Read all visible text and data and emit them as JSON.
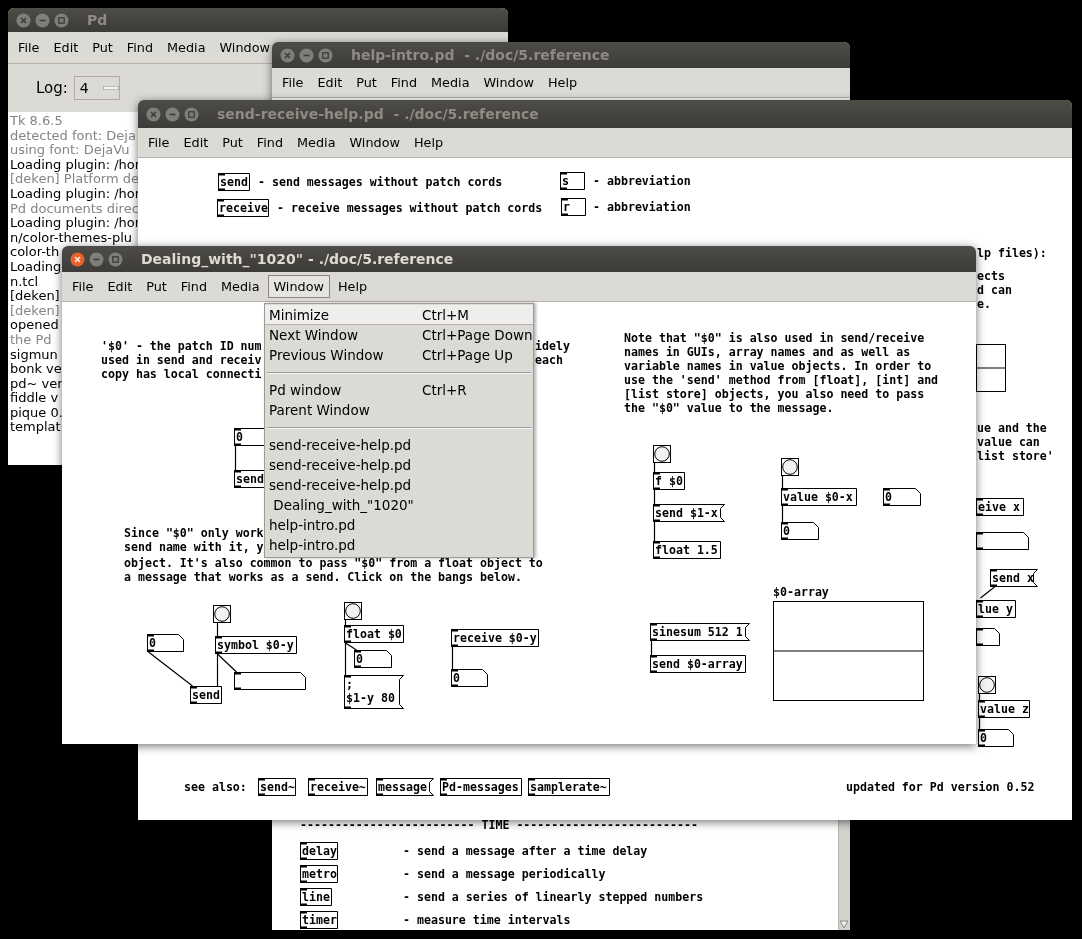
{
  "windows": [
    {
      "kind": "console",
      "title": "Pd",
      "active": false,
      "menus": [
        {
          "label": "File",
          "selected": false
        },
        {
          "label": "Edit",
          "selected": false
        },
        {
          "label": "Put",
          "selected": false
        },
        {
          "label": "Find",
          "selected": false
        },
        {
          "label": "Media",
          "selected": false
        },
        {
          "label": "Window",
          "selected": false
        }
      ],
      "log_label": "Log:",
      "log_value": "4",
      "lines": [
        {
          "text": "Tk 8.6.5",
          "dim": true
        },
        {
          "text": "detected font: Deja",
          "dim": true
        },
        {
          "text": "using font: DejaVu",
          "dim": true
        },
        {
          "text": "Loading plugin: /hor",
          "dim": false
        },
        {
          "text": "[deken] Platform de",
          "dim": true
        },
        {
          "text": "Loading plugin: /hor",
          "dim": false
        },
        {
          "text": "Pd documents direc",
          "dim": true
        },
        {
          "text": "Loading plugin: /hor",
          "dim": false
        },
        {
          "text": "n/color-themes-plu",
          "dim": false
        },
        {
          "text": "color-th",
          "dim": false
        },
        {
          "text": "Loading",
          "dim": false
        },
        {
          "text": "n.tcl",
          "dim": false
        },
        {
          "text": "[deken]",
          "dim": false
        },
        {
          "text": "[deken]",
          "dim": true
        },
        {
          "text": "opened",
          "dim": false
        },
        {
          "text": "the Pd",
          "dim": true
        },
        {
          "text": "sigmun",
          "dim": false
        },
        {
          "text": "bonk ve",
          "dim": false
        },
        {
          "text": "pd~ ver",
          "dim": false
        },
        {
          "text": "fiddle v",
          "dim": false
        },
        {
          "text": "pique 0.",
          "dim": false
        },
        {
          "text": "templat",
          "dim": false
        }
      ]
    },
    {
      "kind": "patch",
      "title": "help-intro.pd  - ./doc/5.reference",
      "active": false,
      "menus": [
        {
          "label": "File",
          "selected": false
        },
        {
          "label": "Edit",
          "selected": false
        },
        {
          "label": "Put",
          "selected": false
        },
        {
          "label": "Find",
          "selected": false
        },
        {
          "label": "Media",
          "selected": false
        },
        {
          "label": "Window",
          "selected": false
        },
        {
          "label": "Help",
          "selected": false
        }
      ],
      "objects": [
        {
          "kind": "comment",
          "text": "------------------------- TIME --------------------------"
        },
        {
          "kind": "obj",
          "text": "delay"
        },
        {
          "kind": "comment",
          "text": "- send a message after a time delay"
        },
        {
          "kind": "obj",
          "text": "metro"
        },
        {
          "kind": "comment",
          "text": "- send a message periodically"
        },
        {
          "kind": "obj",
          "text": "line"
        },
        {
          "kind": "comment",
          "text": "- send a series of linearly stepped numbers"
        },
        {
          "kind": "obj",
          "text": "timer"
        },
        {
          "kind": "comment",
          "text": "- measure time intervals"
        }
      ]
    },
    {
      "kind": "patch",
      "title": "send-receive-help.pd  - ./doc/5.reference",
      "active": false,
      "menus": [
        {
          "label": "File",
          "selected": false
        },
        {
          "label": "Edit",
          "selected": false
        },
        {
          "label": "Put",
          "selected": false
        },
        {
          "label": "Find",
          "selected": false
        },
        {
          "label": "Media",
          "selected": false
        },
        {
          "label": "Window",
          "selected": false
        },
        {
          "label": "Help",
          "selected": false
        }
      ],
      "objects": [
        {
          "kind": "obj",
          "text": "send"
        },
        {
          "kind": "comment",
          "text": "- send messages without patch cords"
        },
        {
          "kind": "obj",
          "text": "receive"
        },
        {
          "kind": "comment",
          "text": "- receive messages without patch cords"
        },
        {
          "kind": "obj",
          "text": "s"
        },
        {
          "kind": "comment",
          "text": "- abbreviation"
        },
        {
          "kind": "obj",
          "text": "r"
        },
        {
          "kind": "comment",
          "text": "- abbreviation"
        },
        {
          "kind": "comment",
          "text": "lp files):"
        },
        {
          "kind": "comment",
          "text": "ects\nd can\ne."
        },
        {
          "kind": "array"
        },
        {
          "kind": "comment",
          "text": "ue and the\nvalue can\nlist store'"
        },
        {
          "kind": "obj",
          "text": "eive x"
        },
        {
          "kind": "atom"
        },
        {
          "kind": "msg",
          "text": "send x"
        },
        {
          "kind": "obj",
          "text": "lue y"
        },
        {
          "kind": "atom"
        },
        {
          "kind": "bng"
        },
        {
          "kind": "obj",
          "text": "value z"
        },
        {
          "kind": "num",
          "text": "0"
        },
        {
          "kind": "comment",
          "text": "see also:"
        },
        {
          "kind": "obj",
          "text": "send~"
        },
        {
          "kind": "obj",
          "text": "receive~"
        },
        {
          "kind": "msg",
          "text": "message"
        },
        {
          "kind": "obj",
          "text": "Pd-messages"
        },
        {
          "kind": "obj",
          "text": "samplerate~"
        },
        {
          "kind": "comment",
          "text": "updated for Pd version 0.52"
        }
      ]
    },
    {
      "kind": "patch",
      "title": "Dealing_with_\"1020\" - ./doc/5.reference",
      "active": true,
      "menus": [
        {
          "label": "File",
          "selected": false
        },
        {
          "label": "Edit",
          "selected": false
        },
        {
          "label": "Put",
          "selected": false
        },
        {
          "label": "Find",
          "selected": false
        },
        {
          "label": "Media",
          "selected": false
        },
        {
          "label": "Window",
          "selected": true
        },
        {
          "label": "Help",
          "selected": false
        }
      ],
      "objects": [
        {
          "kind": "comment",
          "text": "'$0' - the patch ID num\nused in send and receiv\ncopy has local connecti"
        },
        {
          "kind": "comment",
          "text": "idely"
        },
        {
          "kind": "comment",
          "text": "each"
        },
        {
          "kind": "comment",
          "text": "Since \"$0\" only work\nsend name with it, y"
        },
        {
          "kind": "comment",
          "text": "object. It's also common to pass \"$0\" from a float object to\na message that works as a send. Click on the bangs below."
        },
        {
          "kind": "comment",
          "text": "Note that \"$0\" is also used in send/receive\nnames in GUIs, array names and as well as\nvariable names in value objects. In order to\nuse the 'send' method from [float], [int] and\n[list store] objects, you also need to pass\nthe \"$0\" value to the message."
        },
        {
          "kind": "num",
          "text": "0"
        },
        {
          "kind": "obj",
          "text": "send"
        },
        {
          "kind": "bng"
        },
        {
          "kind": "num",
          "text": "0"
        },
        {
          "kind": "obj",
          "text": "symbol $0-y"
        },
        {
          "kind": "atom"
        },
        {
          "kind": "obj",
          "text": "send"
        },
        {
          "kind": "bng"
        },
        {
          "kind": "obj",
          "text": "float $0"
        },
        {
          "kind": "num",
          "text": "0"
        },
        {
          "kind": "msg",
          "text": ";\n$1-y 80"
        },
        {
          "kind": "obj",
          "text": "receive $0-y"
        },
        {
          "kind": "num",
          "text": "0"
        },
        {
          "kind": "bng"
        },
        {
          "kind": "obj",
          "text": "f $0"
        },
        {
          "kind": "msg",
          "text": "send $1-x"
        },
        {
          "kind": "obj",
          "text": "float 1.5"
        },
        {
          "kind": "bng"
        },
        {
          "kind": "obj",
          "text": "value $0-x"
        },
        {
          "kind": "num",
          "text": "0"
        },
        {
          "kind": "num",
          "text": "0"
        },
        {
          "kind": "msg",
          "text": "sinesum 512 1"
        },
        {
          "kind": "obj",
          "text": "send $0-array"
        },
        {
          "kind": "array",
          "text": "$0-array"
        }
      ],
      "menu_dropdown": [
        {
          "kind": "item",
          "label": "Minimize",
          "shortcut": "Ctrl+M",
          "selected": true
        },
        {
          "kind": "item",
          "label": "Next Window",
          "shortcut": "Ctrl+Page Down",
          "selected": false
        },
        {
          "kind": "item",
          "label": "Previous Window",
          "shortcut": "Ctrl+Page Up",
          "selected": false
        },
        {
          "kind": "separator"
        },
        {
          "kind": "item",
          "label": "Pd window",
          "shortcut": "Ctrl+R",
          "selected": false
        },
        {
          "kind": "item",
          "label": "Parent Window",
          "selected": false
        },
        {
          "kind": "separator"
        },
        {
          "kind": "item",
          "label": "send-receive-help.pd",
          "selected": false
        },
        {
          "kind": "item",
          "label": "send-receive-help.pd",
          "selected": false
        },
        {
          "kind": "item",
          "label": "send-receive-help.pd",
          "selected": false
        },
        {
          "kind": "item",
          "label": " Dealing_with_\"1020\"",
          "selected": false
        },
        {
          "kind": "item",
          "label": "help-intro.pd",
          "selected": false
        },
        {
          "kind": "item",
          "label": "help-intro.pd",
          "selected": false
        }
      ]
    }
  ]
}
